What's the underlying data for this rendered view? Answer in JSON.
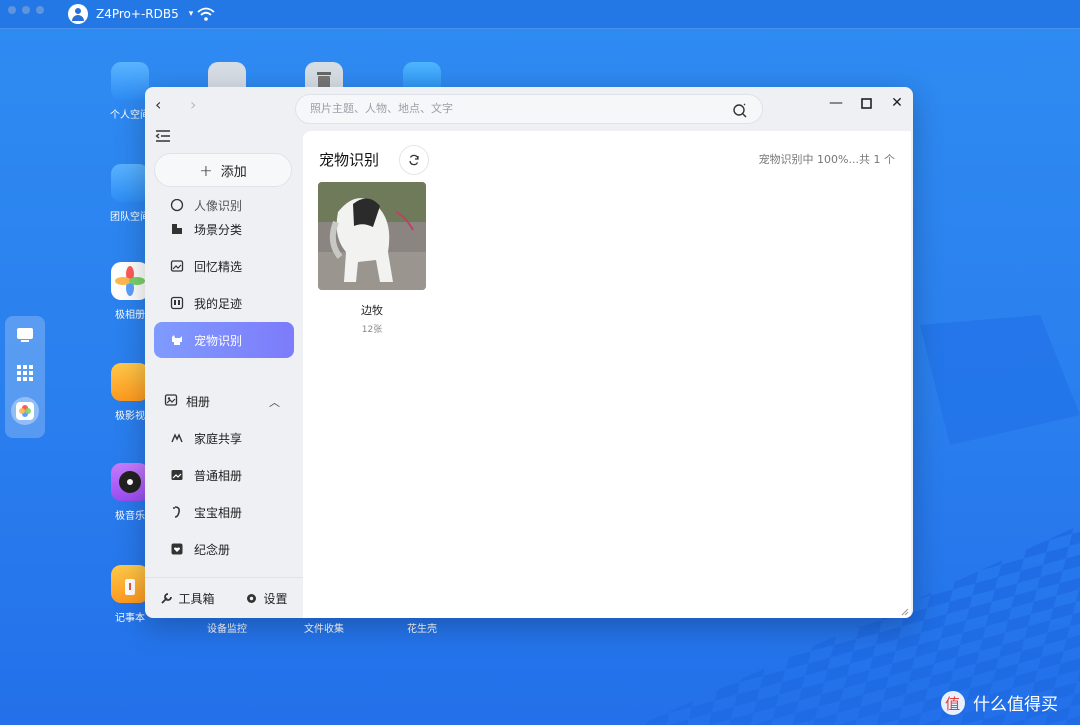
{
  "topbar": {
    "device_name": "Z4Pro+-RDB5",
    "right_icons": [
      "speedometer-icon",
      "terminal-icon",
      "mail-icon",
      "gear-icon"
    ]
  },
  "desktop": {
    "icons": [
      {
        "label": "个人空间",
        "color": "#3aa0ff",
        "icon": "folder-icon"
      },
      {
        "label": "团队空间",
        "color": "#3aa0ff",
        "icon": "team-folder-icon"
      },
      {
        "label": "极相册",
        "color": "#ffffff",
        "icon": "photos-icon"
      },
      {
        "label": "极影视",
        "color": "#ffb020",
        "icon": "video-icon"
      },
      {
        "label": "极音乐",
        "color": "#b85cf0",
        "icon": "music-icon"
      },
      {
        "label": "记事本",
        "color": "#ffb020",
        "icon": "notepad-icon"
      },
      {
        "label": "设备监控",
        "color": "#c9d1d9",
        "icon": "monitor-icon"
      },
      {
        "label": "文件收集",
        "color": "#c9d1d9",
        "icon": "trash-icon"
      },
      {
        "label": "花生壳",
        "color": "#2c9cff",
        "icon": "transfer-icon"
      }
    ]
  },
  "window": {
    "search_placeholder": "照片主题、人物、地点、文字",
    "sidebar": {
      "add_label": "添加",
      "cut_item_label": "人像识别",
      "items": [
        {
          "label": "场景分类",
          "icon": "scene-icon"
        },
        {
          "label": "回忆精选",
          "icon": "memory-icon"
        },
        {
          "label": "我的足迹",
          "icon": "footprint-icon"
        },
        {
          "label": "宠物识别",
          "icon": "pet-icon",
          "active": true
        }
      ],
      "album_section": {
        "label": "相册",
        "items": [
          {
            "label": "家庭共享",
            "icon": "family-icon"
          },
          {
            "label": "普通相册",
            "icon": "album-icon"
          },
          {
            "label": "宝宝相册",
            "icon": "baby-icon"
          },
          {
            "label": "纪念册",
            "icon": "heart-album-icon"
          }
        ]
      },
      "footer": {
        "toolbox": "工具箱",
        "settings": "设置"
      }
    },
    "main": {
      "title": "宠物识别",
      "status": "宠物识别中 100%...共 1 个",
      "cards": [
        {
          "name": "边牧",
          "count": "12张"
        }
      ]
    }
  },
  "watermark": "什么值得买",
  "colors": {
    "accent": "#7f9bff",
    "desktop_bg": "#2a7fee",
    "window_bg": "#eef0f4"
  }
}
